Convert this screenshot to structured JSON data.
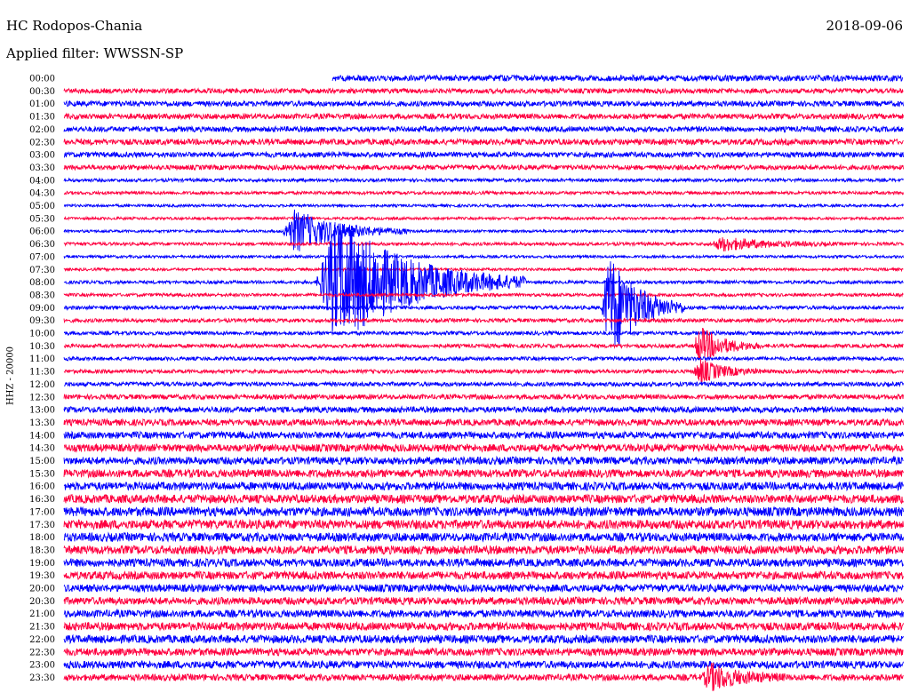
{
  "header": {
    "station": "HC Rodopos-Chania",
    "date": "2018-09-06",
    "filter": "Applied filter: WWSSN-SP",
    "channel": "HHZ - 20000"
  },
  "colors": {
    "trace_a": "#0000ff",
    "trace_b": "#ff0040",
    "background": "#ffffff"
  },
  "chart_data": {
    "type": "line",
    "subtype": "helicorder (seismogram drum plot)",
    "title": "HC Rodopos-Chania",
    "date": "2018-09-06",
    "filter": "WWSSN-SP",
    "ylabel": "HHZ - 20000",
    "row_interval_minutes": 30,
    "row_labels": [
      "00:00",
      "00:30",
      "01:00",
      "01:30",
      "02:00",
      "02:30",
      "03:00",
      "03:30",
      "04:00",
      "04:30",
      "05:00",
      "05:30",
      "06:00",
      "06:30",
      "07:00",
      "07:30",
      "08:00",
      "08:30",
      "09:00",
      "09:30",
      "10:00",
      "10:30",
      "11:00",
      "11:30",
      "12:00",
      "12:30",
      "13:00",
      "13:30",
      "14:00",
      "14:30",
      "15:00",
      "15:30",
      "16:00",
      "16:30",
      "17:00",
      "17:30",
      "18:00",
      "18:30",
      "19:00",
      "19:30",
      "20:00",
      "20:30",
      "21:00",
      "21:30",
      "22:00",
      "22:30",
      "23:00",
      "23:30"
    ],
    "trace_colors_alternate": [
      "blue",
      "red"
    ],
    "data_start_fraction_first_row": 0.32,
    "baseline_noise_level": [
      0.55,
      0.45,
      0.5,
      0.5,
      0.5,
      0.55,
      0.5,
      0.45,
      0.3,
      0.3,
      0.25,
      0.25,
      0.25,
      0.3,
      0.25,
      0.25,
      0.3,
      0.3,
      0.35,
      0.35,
      0.35,
      0.35,
      0.35,
      0.35,
      0.4,
      0.45,
      0.55,
      0.6,
      0.65,
      0.7,
      0.7,
      0.75,
      0.75,
      0.8,
      0.85,
      0.85,
      0.8,
      0.8,
      0.75,
      0.75,
      0.7,
      0.7,
      0.7,
      0.75,
      0.75,
      0.7,
      0.7,
      0.6
    ],
    "events": [
      {
        "row": 12,
        "start_fraction": 0.26,
        "width_fraction": 0.15,
        "amplitude": 4.0
      },
      {
        "row": 16,
        "start_fraction": 0.3,
        "width_fraction": 0.25,
        "amplitude": 12.0
      },
      {
        "row": 18,
        "start_fraction": 0.64,
        "width_fraction": 0.1,
        "amplitude": 10.0
      },
      {
        "row": 21,
        "start_fraction": 0.75,
        "width_fraction": 0.08,
        "amplitude": 3.5
      },
      {
        "row": 23,
        "start_fraction": 0.75,
        "width_fraction": 0.08,
        "amplitude": 2.2
      },
      {
        "row": 13,
        "start_fraction": 0.77,
        "width_fraction": 0.15,
        "amplitude": 1.2
      },
      {
        "row": 47,
        "start_fraction": 0.76,
        "width_fraction": 0.1,
        "amplitude": 2.4
      }
    ]
  }
}
